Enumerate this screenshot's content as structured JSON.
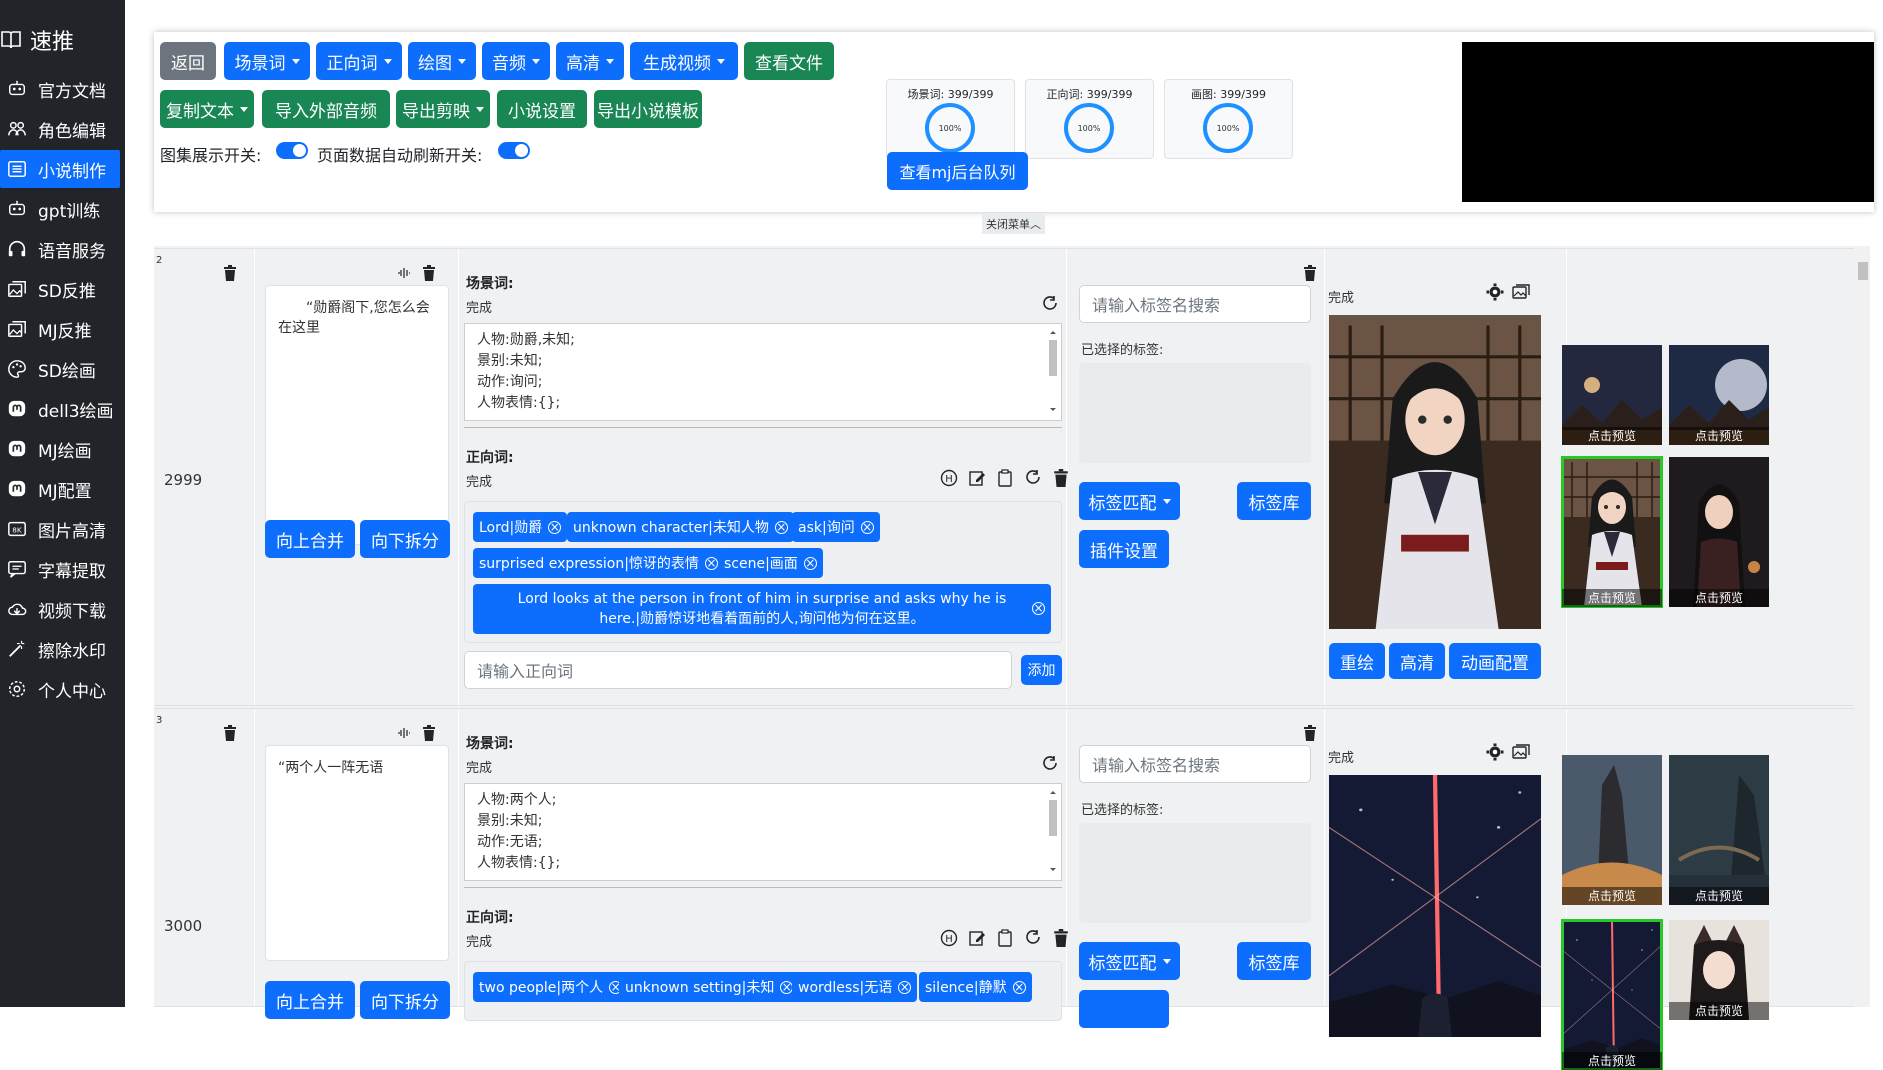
{
  "app": {
    "brand": "速推"
  },
  "sidebar": {
    "items": [
      {
        "label": "官方文档",
        "icon": "robot-icon",
        "active": false
      },
      {
        "label": "角色编辑",
        "icon": "people-icon",
        "active": false
      },
      {
        "label": "小说制作",
        "icon": "list-icon",
        "active": true
      },
      {
        "label": "gpt训练",
        "icon": "robot-icon",
        "active": false
      },
      {
        "label": "语音服务",
        "icon": "headphones-icon",
        "active": false
      },
      {
        "label": "SD反推",
        "icon": "images-icon",
        "active": false
      },
      {
        "label": "MJ反推",
        "icon": "images-icon",
        "active": false
      },
      {
        "label": "SD绘画",
        "icon": "palette-icon",
        "active": false
      },
      {
        "label": "dell3绘画",
        "icon": "mastodon-icon",
        "active": false
      },
      {
        "label": "MJ绘画",
        "icon": "mastodon-icon",
        "active": false
      },
      {
        "label": "MJ配置",
        "icon": "mastodon-icon",
        "active": false
      },
      {
        "label": "图片高清",
        "icon": "8k-icon",
        "active": false
      },
      {
        "label": "字幕提取",
        "icon": "subtitle-icon",
        "active": false
      },
      {
        "label": "视频下载",
        "icon": "cloud-download-icon",
        "active": false
      },
      {
        "label": "擦除水印",
        "icon": "magic-wand-icon",
        "active": false
      },
      {
        "label": "个人中心",
        "icon": "gear-icon",
        "active": false
      }
    ]
  },
  "toolbar": {
    "back": "返回",
    "scene_words": "场景词",
    "positive_words": "正向词",
    "drawing": "绘图",
    "audio": "音频",
    "hd": "高清",
    "generate_video": "生成视频",
    "view_files": "查看文件",
    "copy_text": "复制文本",
    "import_audio": "导入外部音频",
    "export_jianying": "导出剪映",
    "novel_settings": "小说设置",
    "export_template": "导出小说模板",
    "gallery_switch_label": "图集展示开关:",
    "auto_refresh_label": "页面数据自动刷新开关:",
    "mj_queue": "查看mj后台队列",
    "close_menu": "关闭菜单︿"
  },
  "stats": [
    {
      "label": "场景词: 399/399",
      "percent": "100%"
    },
    {
      "label": "正向词: 399/399",
      "percent": "100%"
    },
    {
      "label": "画图: 399/399",
      "percent": "100%"
    }
  ],
  "rows": [
    {
      "num": "2",
      "id": "2999",
      "text": "“勋爵阁下,您怎么会在这里",
      "merge_up": "向上合并",
      "split_down": "向下拆分",
      "scene_title": "场景词:",
      "scene_status": "完成",
      "scene_lines": [
        "人物:勋爵,未知;",
        "景别:未知;",
        "动作:询问;",
        "人物表情:{};"
      ],
      "pos_title": "正向词:",
      "pos_status": "完成",
      "tags": [
        "Lord|勋爵",
        "unknown character|未知人物",
        "ask|询问",
        "surprised expression|惊讶的表情",
        "scene|画面"
      ],
      "long_tag": "Lord looks at the person in front of him in surprise and asks why he is here.|勋爵惊讶地看着面前的人,询问他为何在这里。",
      "pos_placeholder": "请输入正向词",
      "add": "添加",
      "tag_search_placeholder": "请输入标签名搜索",
      "selected_tags_label": "已选择的标签:",
      "tag_match": "标签匹配",
      "tag_library": "标签库",
      "plugin_settings": "插件设置",
      "image_status": "完成",
      "redraw": "重绘",
      "upscale": "高清",
      "anim_config": "动画配置",
      "thumb_caption": "点击预览"
    },
    {
      "num": "3",
      "id": "3000",
      "text": "“两个人一阵无语",
      "merge_up": "向上合并",
      "split_down": "向下拆分",
      "scene_title": "场景词:",
      "scene_status": "完成",
      "scene_lines": [
        "人物:两个人;",
        "景别:未知;",
        "动作:无语;",
        "人物表情:{};"
      ],
      "pos_title": "正向词:",
      "pos_status": "完成",
      "tags": [
        "two people|两个人",
        "unknown setting|未知",
        "wordless|无语",
        "silence|静默"
      ],
      "tag_search_placeholder": "请输入标签名搜索",
      "selected_tags_label": "已选择的标签:",
      "tag_match": "标签匹配",
      "tag_library": "标签库",
      "image_status": "完成",
      "thumb_caption": "点击预览"
    }
  ]
}
